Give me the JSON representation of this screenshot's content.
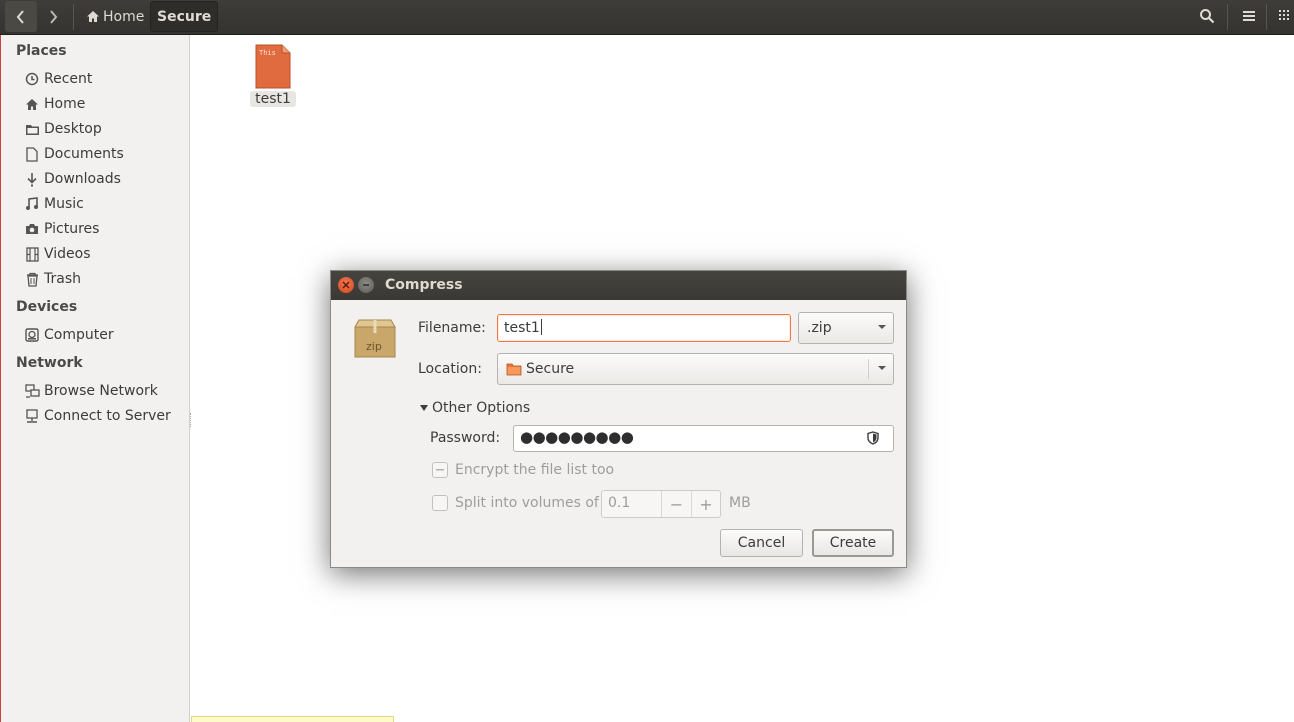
{
  "header": {
    "breadcrumb_home": "Home",
    "breadcrumb_current": "Secure"
  },
  "sidebar": {
    "places_heading": "Places",
    "places": [
      {
        "label": "Recent",
        "icon": "clock-icon"
      },
      {
        "label": "Home",
        "icon": "home-icon"
      },
      {
        "label": "Desktop",
        "icon": "folder-icon"
      },
      {
        "label": "Documents",
        "icon": "document-icon"
      },
      {
        "label": "Downloads",
        "icon": "download-icon"
      },
      {
        "label": "Music",
        "icon": "music-icon"
      },
      {
        "label": "Pictures",
        "icon": "camera-icon"
      },
      {
        "label": "Videos",
        "icon": "film-icon"
      },
      {
        "label": "Trash",
        "icon": "trash-icon"
      }
    ],
    "devices_heading": "Devices",
    "devices": [
      {
        "label": "Computer",
        "icon": "drive-icon"
      }
    ],
    "network_heading": "Network",
    "network": [
      {
        "label": "Browse Network",
        "icon": "network-icon"
      },
      {
        "label": "Connect to Server",
        "icon": "server-icon"
      }
    ]
  },
  "files": [
    {
      "name": "test1",
      "thumb_text": "This"
    }
  ],
  "dialog": {
    "title": "Compress",
    "zip_icon_text": "zip",
    "filename_label": "Filename:",
    "filename_value": "test1",
    "extension_value": ".zip",
    "location_label": "Location:",
    "location_value": "Secure",
    "other_options_label": "Other Options",
    "password_label": "Password:",
    "password_mask": "●●●●●●●●●",
    "encrypt_label": "Encrypt the file list too",
    "split_label": "Split into volumes of",
    "split_value": "0.1",
    "split_minus": "−",
    "split_plus": "+",
    "split_unit": "MB",
    "cancel_label": "Cancel",
    "create_label": "Create"
  },
  "colors": {
    "accent": "#f07746",
    "header_bg": "#3c3b37",
    "sidebar_bg": "#f2f1f0"
  }
}
